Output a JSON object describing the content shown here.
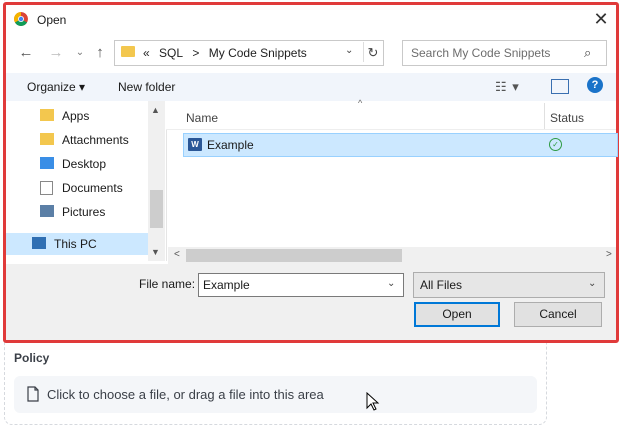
{
  "page": {
    "policy_label": "Policy",
    "upload_text": "Click to choose a file, or drag a file into this area"
  },
  "dialog": {
    "title": "Open",
    "address": {
      "prefix": "«",
      "items": [
        "SQL",
        ">",
        "My Code Snippets"
      ]
    },
    "search_placeholder": "Search My Code Snippets",
    "toolbar": {
      "organize": "Organize ▾",
      "new_folder": "New folder"
    },
    "nav": [
      "Apps",
      "Attachments",
      "Desktop",
      "Documents",
      "Pictures",
      "This PC"
    ],
    "columns": {
      "name": "Name",
      "status": "Status"
    },
    "file": {
      "name": "Example",
      "icon_letter": "W"
    },
    "filename_label": "File name:",
    "filename_value": "Example",
    "file_type": "All Files",
    "open_label": "Open",
    "cancel_label": "Cancel"
  },
  "colors": {
    "accent": "#0078d7",
    "highlight": "#e03a3a",
    "selection": "#cce8ff",
    "folder": "#f3c74e"
  }
}
